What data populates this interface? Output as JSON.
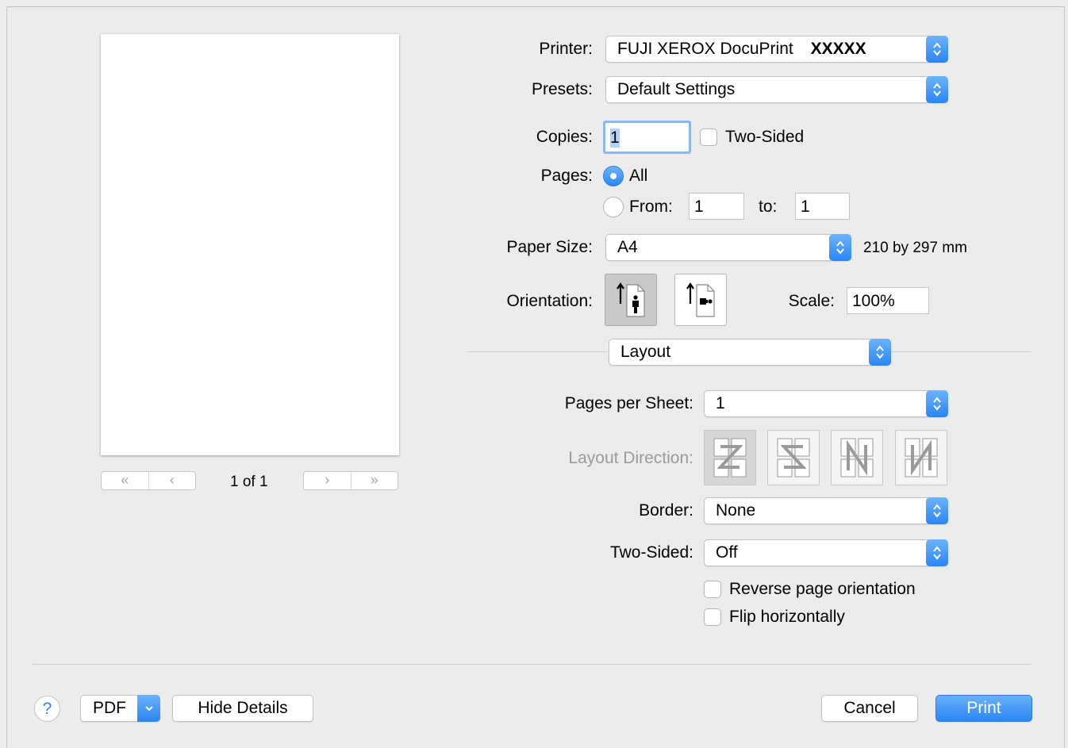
{
  "preview": {
    "page_indicator": "1 of 1"
  },
  "printer": {
    "label": "Printer:",
    "value": "FUJI XEROX DocuPrint",
    "value_model": "XXXXX"
  },
  "presets": {
    "label": "Presets:",
    "value": "Default Settings"
  },
  "copies": {
    "label": "Copies:",
    "value": "1",
    "two_sided_label": "Two-Sided"
  },
  "pages": {
    "label": "Pages:",
    "all_label": "All",
    "from_label": "From:",
    "from_value": "1",
    "to_label": "to:",
    "to_value": "1"
  },
  "paper_size": {
    "label": "Paper Size:",
    "value": "A4",
    "dimensions": "210 by 297 mm"
  },
  "orientation": {
    "label": "Orientation:",
    "selected": "portrait"
  },
  "scale": {
    "label": "Scale:",
    "value": "100%"
  },
  "section": {
    "value": "Layout"
  },
  "pages_per_sheet": {
    "label": "Pages per Sheet:",
    "value": "1"
  },
  "layout_direction": {
    "label": "Layout Direction:",
    "icons": [
      "z-direction-icon",
      "reverse-z-direction-icon",
      "n-direction-icon",
      "reverse-n-direction-icon"
    ]
  },
  "border": {
    "label": "Border:",
    "value": "None"
  },
  "layout_two_sided": {
    "label": "Two-Sided:",
    "value": "Off"
  },
  "reverse_orientation": {
    "label": "Reverse page orientation"
  },
  "flip_horizontally": {
    "label": "Flip horizontally"
  },
  "footer": {
    "help": "?",
    "pdf_label": "PDF",
    "hide_details_label": "Hide Details",
    "cancel_label": "Cancel",
    "print_label": "Print"
  },
  "colors": {
    "accent": "#2a85f5",
    "dim_text": "#9a9a9a"
  }
}
